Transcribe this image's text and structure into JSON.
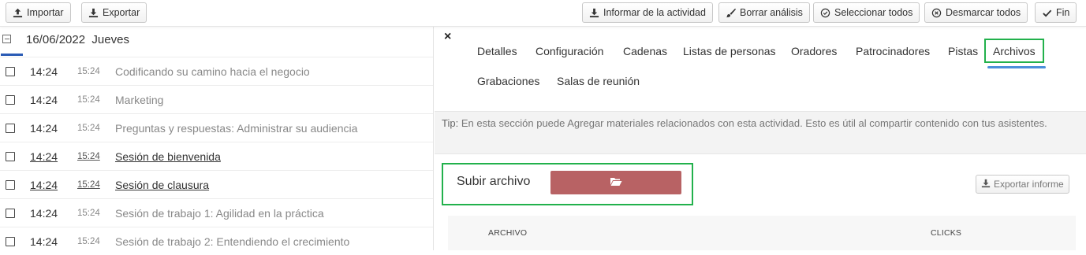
{
  "toolbar": {
    "import_label": "Importar",
    "export_label": "Exportar",
    "report_label": "Informar de la actividad",
    "clear_label": "Borrar análisis",
    "select_all_label": "Seleccionar todos",
    "deselect_all_label": "Desmarcar todos",
    "finish_label": "Fin"
  },
  "day": {
    "date": "16/06/2022",
    "weekday": "Jueves"
  },
  "events": [
    {
      "start": "14:24",
      "end": "15:24",
      "title": "Codificando su camino hacia el negocio",
      "linked": false
    },
    {
      "start": "14:24",
      "end": "15:24",
      "title": "Marketing",
      "linked": false
    },
    {
      "start": "14:24",
      "end": "15:24",
      "title": "Preguntas y respuestas: Administrar su audiencia",
      "linked": false
    },
    {
      "start": "14:24",
      "end": "15:24",
      "title": "Sesión de bienvenida",
      "linked": true
    },
    {
      "start": "14:24",
      "end": "15:24",
      "title": "Sesión de clausura",
      "linked": true
    },
    {
      "start": "14:24",
      "end": "15:24",
      "title": "Sesión de trabajo 1: Agilidad en la práctica",
      "linked": false
    },
    {
      "start": "14:24",
      "end": "15:24",
      "title": "Sesión de trabajo 2: Entendiendo el crecimiento",
      "linked": false
    }
  ],
  "panel": {
    "close_glyph": "×",
    "tabs": [
      "Detalles",
      "Configuración",
      "Cadenas",
      "Listas de personas",
      "Oradores",
      "Patrocinadores",
      "Pistas",
      "Archivos",
      "Grabaciones",
      "Salas de reunión"
    ],
    "active_tab": "Archivos",
    "tip_label": "Tip:",
    "tip_text": "En esta sección puede Agregar materiales relacionados con esta actividad. Esto es útil al compartir contenido con tus asistentes.",
    "upload_label": "Subir archivo",
    "export_report_label": "Exportar informe",
    "columns": [
      "ARCHIVO",
      "CLICKS"
    ]
  },
  "colors": {
    "upload_button": "#b86264",
    "highlight_border": "#22b14c",
    "active_tab_underline": "#4a8fdb",
    "day_underline": "#2a5bb5"
  }
}
